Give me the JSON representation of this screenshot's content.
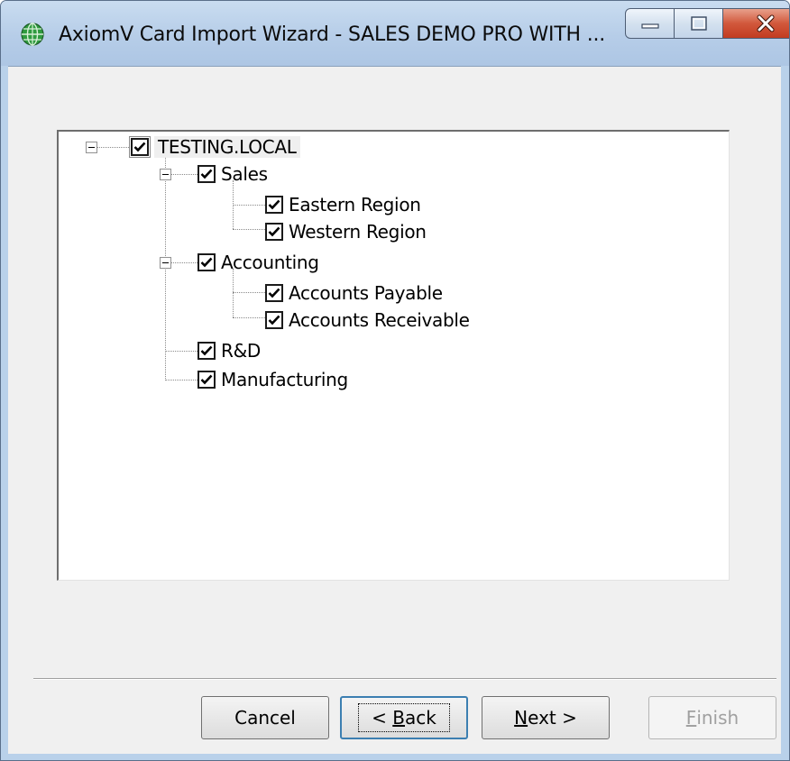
{
  "window": {
    "title": "AxiomV  Card Import Wizard - SALES DEMO PRO WITH ...",
    "accent": "#b9d1ea",
    "close_color": "#c23b20"
  },
  "caption_icons": [
    "minimize-icon",
    "maximize-icon",
    "close-icon"
  ],
  "tree": {
    "root": {
      "label": "TESTING.LOCAL",
      "checked": true
    },
    "sales": {
      "label": "Sales",
      "checked": true
    },
    "eastern": {
      "label": "Eastern Region",
      "checked": true
    },
    "western": {
      "label": "Western Region",
      "checked": true
    },
    "accounting": {
      "label": "Accounting",
      "checked": true
    },
    "payable": {
      "label": "Accounts Payable",
      "checked": true
    },
    "receivable": {
      "label": "Accounts Receivable",
      "checked": true
    },
    "rnd": {
      "label": "R&D",
      "checked": true
    },
    "manufacturing": {
      "label": "Manufacturing",
      "checked": true
    }
  },
  "buttons": {
    "cancel": "Cancel",
    "back_prefix": "< ",
    "back_mnemonic": "B",
    "back_rest": "ack",
    "next_mnemonic": "N",
    "next_rest": "ext >",
    "finish_mnemonic": "F",
    "finish_rest": "inish"
  }
}
